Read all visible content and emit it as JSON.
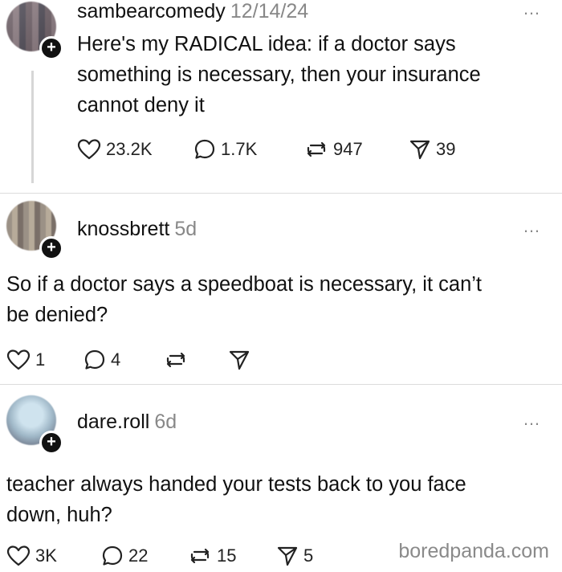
{
  "posts": [
    {
      "username": "sambearcomedy",
      "time": "12/14/24",
      "text_lines": [
        "Here's my RADICAL idea: if a doctor says",
        "something is necessary, then your  insurance",
        "cannot deny it"
      ],
      "likes": "23.2K",
      "replies": "1.7K",
      "reposts": "947",
      "shares": "39"
    },
    {
      "username": "knossbrett",
      "time": "5d",
      "text_lines": [
        "So if a doctor says a speedboat is necessary, it can’t",
        "be denied?"
      ],
      "likes": "1",
      "replies": "4",
      "reposts": "",
      "shares": ""
    },
    {
      "username": "dare.roll",
      "time": "6d",
      "text_lines": [
        "teacher always handed your tests back to you face",
        "down, huh?"
      ],
      "likes": "3K",
      "replies": "22",
      "reposts": "15",
      "shares": "5"
    }
  ],
  "more_glyph": "…",
  "plus_glyph": "+",
  "watermark": "boredpanda.com",
  "icons": {
    "like": "heart-icon",
    "reply": "comment-icon",
    "repost": "repost-icon",
    "share": "share-icon"
  }
}
